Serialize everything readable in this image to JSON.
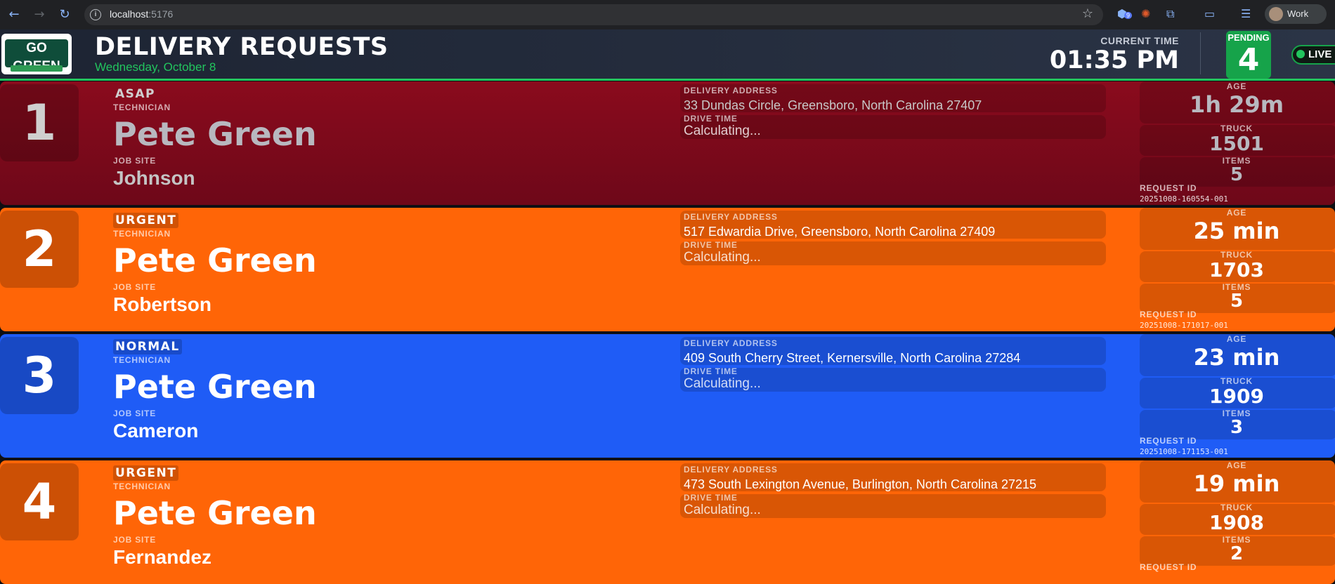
{
  "browser": {
    "url_host": "localhost",
    "url_port": ":5176",
    "extension_badge": "9",
    "profile_name": "Work"
  },
  "header": {
    "logo_text": "GO GREEN",
    "title": "DELIVERY REQUESTS",
    "date": "Wednesday, October 8",
    "current_time_label": "CURRENT TIME",
    "current_time": "01:35 PM",
    "pending_label": "PENDING",
    "pending_count": "4",
    "live_label": "LIVE"
  },
  "labels": {
    "technician": "TECHNICIAN",
    "job_site": "JOB SITE",
    "delivery_address": "DELIVERY ADDRESS",
    "drive_time": "DRIVE TIME",
    "age": "AGE",
    "truck": "TRUCK",
    "items": "ITEMS",
    "request_id": "REQUEST ID"
  },
  "requests": [
    {
      "number": "1",
      "priority": "ASAP",
      "technician": "Pete Green",
      "job_site": "Johnson",
      "address": "33 Dundas Circle, Greensboro, North Carolina 27407",
      "drive_time": "Calculating...",
      "age": "1h 29m",
      "truck": "1501",
      "items": "5",
      "request_id": "20251008-160554-001",
      "color": "#8a0b1d"
    },
    {
      "number": "2",
      "priority": "URGENT",
      "technician": "Pete Green",
      "job_site": "Robertson",
      "address": "517 Edwardia Drive, Greensboro, North Carolina 27409",
      "drive_time": "Calculating...",
      "age": "25 min",
      "truck": "1703",
      "items": "5",
      "request_id": "20251008-171017-001",
      "color": "#ff6507"
    },
    {
      "number": "3",
      "priority": "NORMAL",
      "technician": "Pete Green",
      "job_site": "Cameron",
      "address": "409 South Cherry Street, Kernersville, North Carolina 27284",
      "drive_time": "Calculating...",
      "age": "23 min",
      "truck": "1909",
      "items": "3",
      "request_id": "20251008-171153-001",
      "color": "#1f5cf6"
    },
    {
      "number": "4",
      "priority": "URGENT",
      "technician": "Pete Green",
      "job_site": "Fernandez",
      "address": "473 South Lexington Avenue, Burlington, North Carolina 27215",
      "drive_time": "Calculating...",
      "age": "19 min",
      "truck": "1908",
      "items": "2",
      "request_id": "",
      "color": "#ff6507"
    }
  ]
}
